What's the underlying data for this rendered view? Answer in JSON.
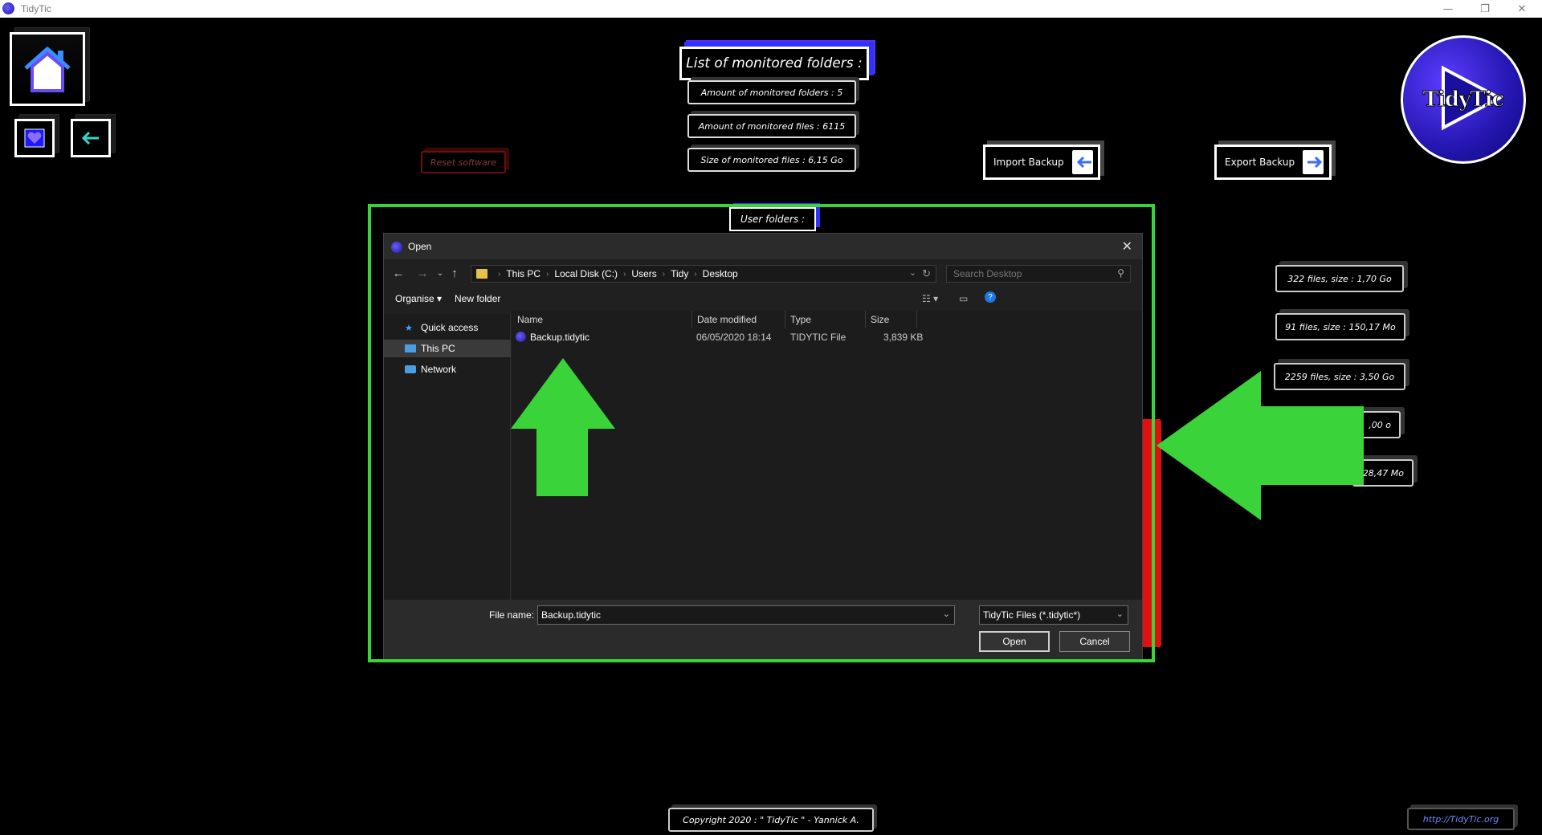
{
  "window": {
    "title": "TidyTic",
    "min": "—",
    "max": "❐",
    "close": "✕"
  },
  "header": {
    "title": "List of monitored folders :"
  },
  "stats": {
    "folders": "Amount of monitored folders : 5",
    "files": "Amount of monitored files : 6115",
    "size": "Size of monitored files : 6,15 Go"
  },
  "buttons": {
    "reset": "Reset software",
    "import": "Import Backup",
    "export": "Export Backup"
  },
  "logo": {
    "text": "TidyTic"
  },
  "user_folders": {
    "label": "User folders :"
  },
  "side_info": [
    "322 files, size : 1,70 Go",
    "91 files, size : 150,17 Mo",
    "2259 files, size : 3,50 Go",
    ",00 o",
    "28,47 Mo"
  ],
  "footer": {
    "copyright": "Copyright 2020 : \" TidyTic \" - Yannick A.",
    "url": "http://TidyTic.org"
  },
  "dialog": {
    "title": "Open",
    "breadcrumb": [
      "This PC",
      "Local Disk (C:)",
      "Users",
      "Tidy",
      "Desktop"
    ],
    "search_placeholder": "Search Desktop",
    "toolbar": {
      "organise": "Organise ▾",
      "new_folder": "New folder"
    },
    "nav": [
      "Quick access",
      "This PC",
      "Network"
    ],
    "columns": [
      "Name",
      "Date modified",
      "Type",
      "Size"
    ],
    "files": [
      {
        "name": "Backup.tidytic",
        "date": "06/05/2020 18:14",
        "type": "TIDYTIC File",
        "size": "3,839 KB"
      }
    ],
    "file_name_label": "File name:",
    "file_name_value": "Backup.tidytic",
    "file_type": "TidyTic Files (*.tidytic*)",
    "open": "Open",
    "cancel": "Cancel"
  },
  "colors": {
    "highlight": "#3ad43a",
    "arrow": "#3ad43a",
    "accent": "#3030ff",
    "danger": "#e01010"
  }
}
